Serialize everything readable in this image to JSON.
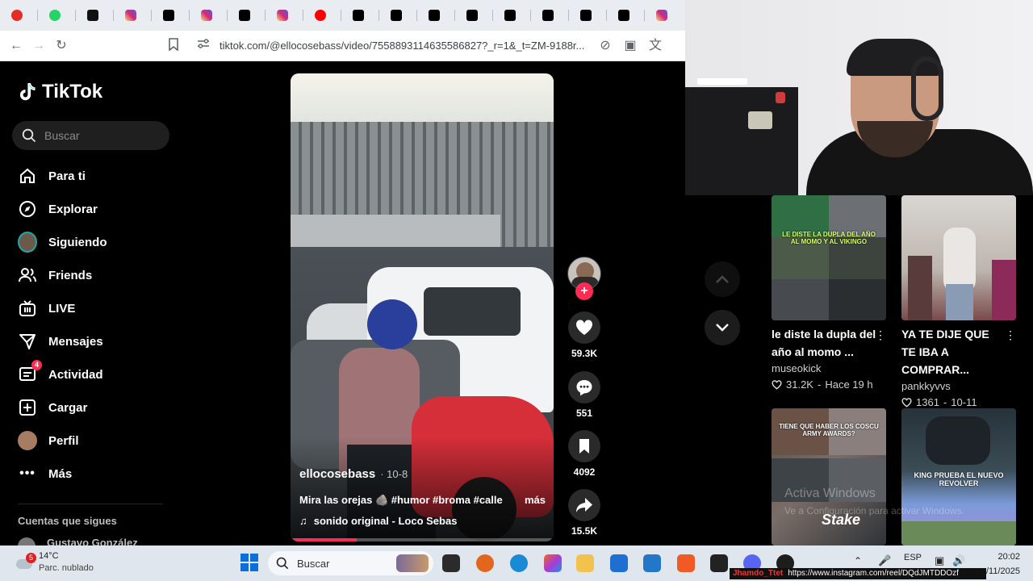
{
  "browser": {
    "url": "tiktok.com/@ellocosebass/video/7558893114635586827?_r=1&_t=ZM-9188r...",
    "tabs": [
      {
        "icon": "youtube-music-icon",
        "color": "#e52d27"
      },
      {
        "icon": "whatsapp-icon",
        "color": "#25d366"
      },
      {
        "icon": "kick-icon",
        "color": "#111111"
      },
      {
        "icon": "instagram-icon",
        "color": "#d62976"
      },
      {
        "icon": "tiktok-icon",
        "color": "#000000"
      },
      {
        "icon": "instagram-icon",
        "color": "#d62976"
      },
      {
        "icon": "tiktok-icon",
        "color": "#000000"
      },
      {
        "icon": "instagram-icon",
        "color": "#d62976"
      },
      {
        "icon": "youtube-icon",
        "color": "#ff0000"
      },
      {
        "icon": "tiktok-icon",
        "color": "#000000"
      },
      {
        "icon": "tiktok-icon",
        "color": "#000000"
      },
      {
        "icon": "tiktok-icon",
        "color": "#000000"
      },
      {
        "icon": "tiktok-icon",
        "color": "#000000"
      },
      {
        "icon": "tiktok-icon",
        "color": "#000000"
      },
      {
        "icon": "x-icon",
        "color": "#000000"
      },
      {
        "icon": "tiktok-icon",
        "color": "#000000"
      },
      {
        "icon": "tiktok-icon",
        "color": "#000000"
      },
      {
        "icon": "instagram-icon",
        "color": "#d62976"
      }
    ]
  },
  "tiktok": {
    "logo": "TikTok",
    "search_placeholder": "Buscar",
    "nav": [
      {
        "label": "Para ti",
        "icon": "home-icon"
      },
      {
        "label": "Explorar",
        "icon": "compass-icon"
      },
      {
        "label": "Siguiendo",
        "icon": "following-avatar-icon"
      },
      {
        "label": "Friends",
        "icon": "friends-icon"
      },
      {
        "label": "LIVE",
        "icon": "live-icon"
      },
      {
        "label": "Mensajes",
        "icon": "messages-icon"
      },
      {
        "label": "Actividad",
        "icon": "activity-icon",
        "badge": "4"
      },
      {
        "label": "Cargar",
        "icon": "upload-icon"
      },
      {
        "label": "Perfil",
        "icon": "profile-avatar-icon"
      },
      {
        "label": "Más",
        "icon": "more-icon"
      }
    ],
    "following_title": "Cuentas que sigues",
    "following_user": "Gustavo González",
    "video": {
      "author": "ellocosebass",
      "date": "· 10-8",
      "caption": "Mira las orejas 🪨 #humor #broma #calle",
      "more": "más",
      "sound": "sonido original - Loco Sebas",
      "progress": 0.25
    },
    "actions": {
      "likes": "59.3K",
      "comments": "551",
      "saves": "4092",
      "shares": "15.5K"
    },
    "accent": "#fe2c55",
    "recommended": [
      {
        "title": "le diste la dupla del año al momo ...",
        "author": "museokick",
        "likes": "31.2K",
        "time": "Hace 19 h",
        "overlay": "LE DISTE LA DUPLA DEL AÑO AL MOMO Y AL VIKINGO"
      },
      {
        "title": "YA TE DIJE QUE TE IBA A COMPRAR...",
        "author": "pankkyvvs",
        "likes": "1361",
        "time": "10-11",
        "overlay": ""
      },
      {
        "title": "",
        "author": "",
        "likes": "",
        "time": "",
        "overlay": "TIENE QUE HABER LOS COSCU ARMY AWARDS?"
      },
      {
        "title": "",
        "author": "",
        "likes": "",
        "time": "",
        "overlay": "KING PRUEBA EL NUEVO REVOLVER"
      }
    ],
    "watermark": "Stake"
  },
  "windows_activation": {
    "line1": "Activa Windows",
    "line2": "Ve a Configuración para activar Windows."
  },
  "taskbar": {
    "weather_temp": "14°C",
    "weather_desc": "Parc. nublado",
    "weather_badge": "5",
    "search_placeholder": "Buscar",
    "lang": "ESP",
    "time": "20:02",
    "date": "/11/2025",
    "ig_user": "Jhamdo_Ttet",
    "ig_link": "https://www.instagram.com/reel/DQdJMTDDOzf"
  }
}
